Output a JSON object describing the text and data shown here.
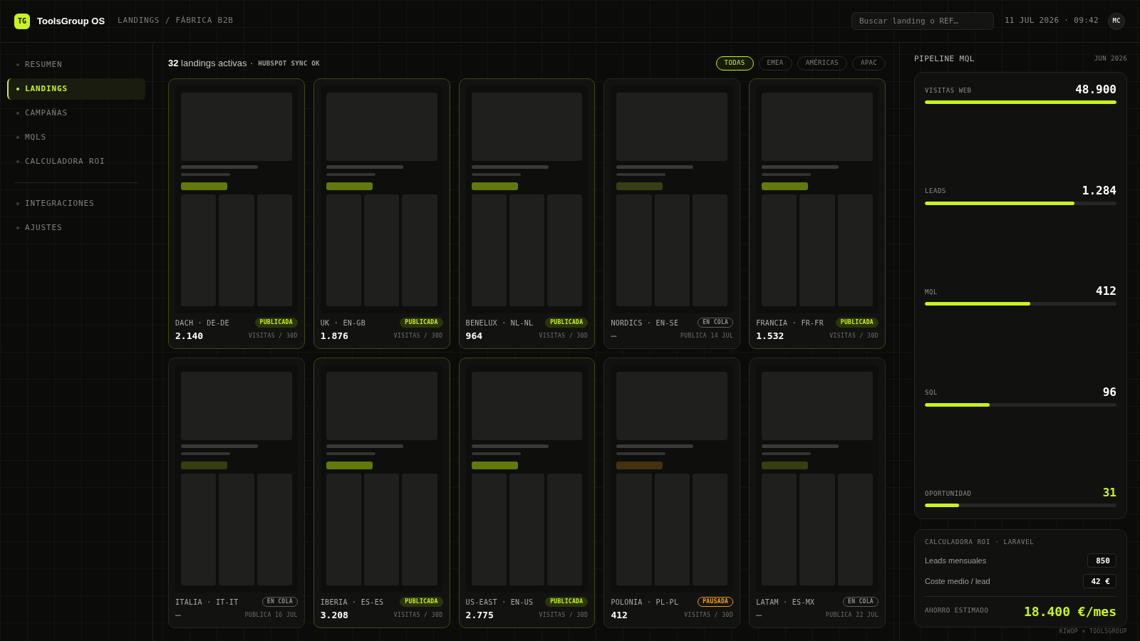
{
  "header": {
    "logo": "TG",
    "brand": "ToolsGroup OS",
    "breadcrumb": "LANDINGS / FÁBRICA B2B",
    "search": {
      "placeholder": "Buscar landing o REF…"
    },
    "datetime": "11 JUL 2026 · 09:42",
    "avatar": "MC"
  },
  "sidebar": {
    "groups": [
      {
        "items": [
          {
            "label": "RESUMEN",
            "selected": false
          },
          {
            "label": "LANDINGS",
            "selected": true
          },
          {
            "label": "CAMPAÑAS",
            "selected": false
          },
          {
            "label": "MQLS",
            "selected": false
          },
          {
            "label": "CALCULADORA ROI",
            "selected": false
          }
        ]
      },
      {
        "items": [
          {
            "label": "INTEGRACIONES",
            "selected": false
          },
          {
            "label": "AJUSTES",
            "selected": false
          }
        ]
      }
    ]
  },
  "main": {
    "summary": "**32** landings activas",
    "sync": "· HUBSPOT SYNC OK",
    "filters": [
      {
        "label": "TODAS",
        "selected": true
      },
      {
        "label": "EMEA",
        "selected": false
      },
      {
        "label": "AMÉRICAS",
        "selected": false
      },
      {
        "label": "APAC",
        "selected": false
      }
    ],
    "cards": [
      {
        "region": "DACH · DE-DE",
        "kind": "published",
        "status": "PUBLICADA",
        "value": "2.140",
        "caption": "VISITAS / 30D"
      },
      {
        "region": "UK · EN-GB",
        "kind": "published",
        "status": "PUBLICADA",
        "value": "1.876",
        "caption": "VISITAS / 30D"
      },
      {
        "region": "BENELUX · NL-NL",
        "kind": "published",
        "status": "PUBLICADA",
        "value": "964",
        "caption": "VISITAS / 30D"
      },
      {
        "region": "NORDICS · EN-SE",
        "kind": "queued",
        "status": "EN COLA",
        "value": "—",
        "caption": "PUBLICA 14 JUL"
      },
      {
        "region": "FRANCIA · FR-FR",
        "kind": "published",
        "status": "PUBLICADA",
        "value": "1.532",
        "caption": "VISITAS / 30D"
      },
      {
        "region": "ITALIA · IT-IT",
        "kind": "queued",
        "status": "EN COLA",
        "value": "—",
        "caption": "PUBLICA 16 JUL"
      },
      {
        "region": "IBERIA · ES-ES",
        "kind": "published",
        "status": "PUBLICADA",
        "value": "3.208",
        "caption": "VISITAS / 30D"
      },
      {
        "region": "US-EAST · EN-US",
        "kind": "published",
        "status": "PUBLICADA",
        "value": "2.775",
        "caption": "VISITAS / 30D"
      },
      {
        "region": "POLONIA · PL-PL",
        "kind": "paused",
        "status": "PAUSADA",
        "value": "412",
        "caption": "VISITAS / 30D"
      },
      {
        "region": "LATAM · ES-MX",
        "kind": "queued",
        "status": "EN COLA",
        "value": "—",
        "caption": "PUBLICA 22 JUL"
      }
    ]
  },
  "pipeline": {
    "title": "PIPELINE MQL",
    "period": "JUN 2026",
    "metrics": [
      {
        "label": "VISITAS WEB",
        "value": "48.900",
        "level": 1.0,
        "accent": false
      },
      {
        "label": "LEADS",
        "value": "1.284",
        "level": 0.78,
        "accent": false
      },
      {
        "label": "MQL",
        "value": "412",
        "level": 0.55,
        "accent": false
      },
      {
        "label": "SQL",
        "value": "96",
        "level": 0.34,
        "accent": false
      },
      {
        "label": "OPORTUNIDAD",
        "value": "31",
        "level": 0.18,
        "accent": true
      }
    ]
  },
  "roi": {
    "title": "CALCULADORA ROI · LARAVEL",
    "fields": [
      {
        "label": "Leads mensuales",
        "value": "850"
      },
      {
        "label": "Coste medio / lead",
        "value": "42 €"
      }
    ],
    "result_label": "AHORRO ESTIMADO",
    "result": "18.400 €/mes"
  },
  "footer": "KIWOP × TOOLSGROUP"
}
